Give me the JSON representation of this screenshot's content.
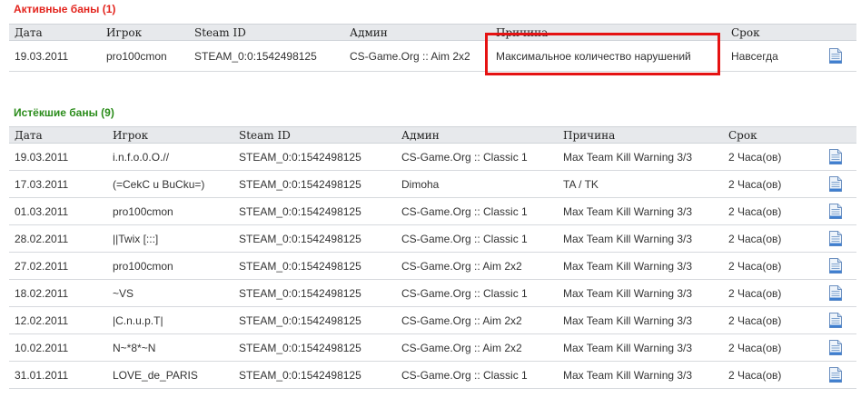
{
  "active": {
    "title": "Активные баны (1)",
    "headers": [
      "Дата",
      "Игрок",
      "Steam ID",
      "Админ",
      "Причина",
      "Срок"
    ],
    "rows": [
      {
        "date": "19.03.2011",
        "player": "pro100cmon",
        "steam": "STEAM_0:0:1542498125",
        "admin": "CS-Game.Org :: Aim 2x2",
        "reason": "Максимальное количество нарушений",
        "term": "Навсегда"
      }
    ]
  },
  "expired": {
    "title": "Истёкшие баны (9)",
    "headers": [
      "Дата",
      "Игрок",
      "Steam ID",
      "Админ",
      "Причина",
      "Срок"
    ],
    "rows": [
      {
        "date": "19.03.2011",
        "player": "i.n.f.o.0.O.//",
        "steam": "STEAM_0:0:1542498125",
        "admin": "CS-Game.Org :: Classic 1",
        "reason": "Max Team Kill Warning 3/3",
        "term": "2 Часа(ов)"
      },
      {
        "date": "17.03.2011",
        "player": "(=CekC u BuCku=)",
        "steam": "STEAM_0:0:1542498125",
        "admin": "Dimoha",
        "reason": "TA / TK",
        "term": "2 Часа(ов)"
      },
      {
        "date": "01.03.2011",
        "player": "pro100cmon",
        "steam": "STEAM_0:0:1542498125",
        "admin": "CS-Game.Org :: Classic 1",
        "reason": "Max Team Kill Warning 3/3",
        "term": "2 Часа(ов)"
      },
      {
        "date": "28.02.2011",
        "player": "||Twix [:::]",
        "steam": "STEAM_0:0:1542498125",
        "admin": "CS-Game.Org :: Classic 1",
        "reason": "Max Team Kill Warning 3/3",
        "term": "2 Часа(ов)"
      },
      {
        "date": "27.02.2011",
        "player": "pro100cmon",
        "steam": "STEAM_0:0:1542498125",
        "admin": "CS-Game.Org :: Aim 2x2",
        "reason": "Max Team Kill Warning 3/3",
        "term": "2 Часа(ов)"
      },
      {
        "date": "18.02.2011",
        "player": "~VS",
        "steam": "STEAM_0:0:1542498125",
        "admin": "CS-Game.Org :: Classic 1",
        "reason": "Max Team Kill Warning 3/3",
        "term": "2 Часа(ов)"
      },
      {
        "date": "12.02.2011",
        "player": "|C.n.u.p.T|",
        "steam": "STEAM_0:0:1542498125",
        "admin": "CS-Game.Org :: Aim 2x2",
        "reason": "Max Team Kill Warning 3/3",
        "term": "2 Часа(ов)"
      },
      {
        "date": "10.02.2011",
        "player": "N~*8*~N",
        "steam": "STEAM_0:0:1542498125",
        "admin": "CS-Game.Org :: Aim 2x2",
        "reason": "Max Team Kill Warning 3/3",
        "term": "2 Часа(ов)"
      },
      {
        "date": "31.01.2011",
        "player": "LOVE_de_PARIS",
        "steam": "STEAM_0:0:1542498125",
        "admin": "CS-Game.Org :: Classic 1",
        "reason": "Max Team Kill Warning 3/3",
        "term": "2 Часа(ов)"
      }
    ]
  },
  "icons": {
    "details": "document-icon"
  },
  "colors": {
    "active_title": "#e3241d",
    "expired_title": "#2a8c1a",
    "highlight": "#e51212",
    "header_bg": "#e7e9ec"
  }
}
